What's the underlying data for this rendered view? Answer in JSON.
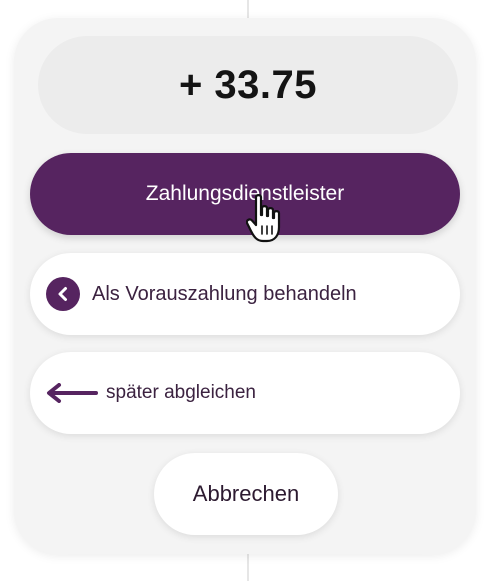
{
  "amount": {
    "value": "+ 33.75"
  },
  "actions": {
    "primary_label": "Zahlungsdienstleister",
    "prepayment_label": "Als Vorauszahlung behandeln",
    "reconcile_later_label": "später abgleichen",
    "cancel_label": "Abbrechen"
  },
  "icons": {
    "prepayment_icon": "chevron-left-circle-icon",
    "reconcile_later_icon": "arrow-left-icon",
    "cursor": "hand-pointer-cursor"
  },
  "colors": {
    "accent": "#562460",
    "panel_bg": "#f4f4f4",
    "amount_bg": "#ececec"
  }
}
